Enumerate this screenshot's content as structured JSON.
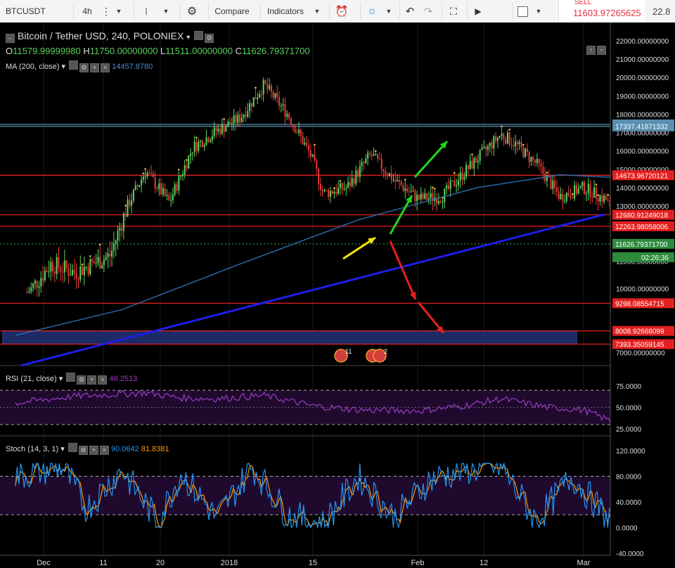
{
  "toolbar": {
    "symbol": "BTCUSDT",
    "interval": "4h",
    "compare_label": "Compare",
    "indicators_label": "Indicators",
    "sell_label": "SELL",
    "sell_price": "11603.97265625",
    "partial_value": "22.8"
  },
  "legend": {
    "title": "Bitcoin / Tether USD, 240, POLONIEX",
    "o_label": "O",
    "o_value": "11579.99999980",
    "h_label": "H",
    "h_value": "11750.00000000",
    "l_label": "L",
    "l_value": "11511.00000000",
    "c_label": "C",
    "c_value": "11626.79371700",
    "ma_label": "MA (200, close)",
    "ma_value": "14457.8780",
    "rsi_label": "RSI (21, close)",
    "rsi_value": "46.2513",
    "stoch_label": "Stoch (14, 3, 1)",
    "stoch_k": "90.0642",
    "stoch_d": "81.8381"
  },
  "colors": {
    "up": "#5fd65f",
    "down": "#e53b3b",
    "ma": "#2d6fb3",
    "trendline": "#1e1ee6",
    "level_line": "#e41f1f",
    "rsi": "#9c3bc2",
    "stoch_k": "#2196f3",
    "stoch_d": "#ff9800",
    "panel_bg": "#1f0a2e",
    "zone": "#1c2a66"
  },
  "chart_data": {
    "type": "candlestick",
    "symbol": "Bitcoin / Tether USD",
    "timeframe": "240",
    "exchange": "POLONIEX",
    "price_axis": [
      "22000.00000000",
      "21000.00000000",
      "20000.00000000",
      "19000.00000000",
      "18000.00000000",
      "17000.00000000",
      "16000.00000000",
      "15000.00000000",
      "14000.00000000",
      "13000.00000000",
      "11000.00000000",
      "10000.00000000",
      "7000.00000000"
    ],
    "price_levels": [
      {
        "price": 17443.41629621,
        "label": "17443.41629621",
        "color": "#5a8fb0"
      },
      {
        "price": 17337.41871332,
        "label": "17337.41871332",
        "color": "#5a8fb0"
      },
      {
        "price": 14673.96720121,
        "label": "14673.96720121",
        "color": "#e41f1f"
      },
      {
        "price": 12680.91249018,
        "label": "12680.91249018",
        "color": "#e41f1f"
      },
      {
        "price": 12263.98058006,
        "label": "12263.98058006",
        "color": "#e41f1f"
      },
      {
        "price": 11626.793717,
        "label": "11626.79371700",
        "color": "#2e8b3d"
      },
      {
        "price": 9298.08554715,
        "label": "9298.08554715",
        "color": "#e41f1f"
      },
      {
        "price": 8008.92668099,
        "label": "8008.92668099",
        "color": "#e41f1f"
      },
      {
        "price": 7393.35059145,
        "label": "7393.35059145",
        "color": "#e41f1f"
      }
    ],
    "countdown": "02:26:36",
    "time_axis": [
      "Dec",
      "11",
      "20",
      "2018",
      "15",
      "Feb",
      "12",
      "Mar"
    ],
    "price_path": [
      [
        "2017-11-27",
        9800
      ],
      [
        "2017-11-29",
        10900
      ],
      [
        "2017-12-01",
        10600
      ],
      [
        "2017-12-04",
        11200
      ],
      [
        "2017-12-07",
        14900
      ],
      [
        "2017-12-09",
        13200
      ],
      [
        "2017-12-11",
        16200
      ],
      [
        "2017-12-13",
        17100
      ],
      [
        "2017-12-15",
        17800
      ],
      [
        "2017-12-17",
        19600
      ],
      [
        "2017-12-19",
        18000
      ],
      [
        "2017-12-21",
        15700
      ],
      [
        "2017-12-22",
        13700
      ],
      [
        "2017-12-24",
        14000
      ],
      [
        "2017-12-26",
        15800
      ],
      [
        "2017-12-28",
        14400
      ],
      [
        "2017-12-30",
        13400
      ],
      [
        "2018-01-01",
        13500
      ],
      [
        "2018-01-03",
        14900
      ],
      [
        "2018-01-06",
        16900
      ],
      [
        "2018-01-07",
        16500
      ],
      [
        "2018-01-09",
        15300
      ],
      [
        "2018-01-11",
        13500
      ],
      [
        "2018-01-13",
        14000
      ],
      [
        "2018-01-15",
        13300
      ],
      [
        "2018-01-16",
        10700
      ],
      [
        "2018-01-17",
        10200
      ],
      [
        "2018-01-18",
        11300
      ],
      [
        "2018-01-19",
        11627
      ]
    ],
    "ma_path": [
      [
        "2017-11-26",
        7800
      ],
      [
        "2017-12-05",
        9000
      ],
      [
        "2017-12-15",
        10900
      ],
      [
        "2017-12-25",
        12500
      ],
      [
        "2018-01-04",
        14000
      ],
      [
        "2018-01-11",
        14700
      ],
      [
        "2018-01-14",
        14600
      ],
      [
        "2018-01-19",
        14457.878
      ]
    ],
    "rsi_axis": [
      "75.0000",
      "50.0000",
      "25.0000"
    ],
    "rsi_levels": [
      70,
      30
    ],
    "rsi_path": [
      [
        "2017-11-26",
        55
      ],
      [
        "2017-12-01",
        63
      ],
      [
        "2017-12-07",
        67
      ],
      [
        "2017-12-10",
        61
      ],
      [
        "2017-12-13",
        60
      ],
      [
        "2017-12-17",
        64
      ],
      [
        "2017-12-21",
        52
      ],
      [
        "2017-12-25",
        47
      ],
      [
        "2017-12-30",
        46
      ],
      [
        "2018-01-03",
        52
      ],
      [
        "2018-01-06",
        60
      ],
      [
        "2018-01-10",
        50
      ],
      [
        "2018-01-13",
        47
      ],
      [
        "2018-01-16",
        30
      ],
      [
        "2018-01-19",
        46.2513
      ]
    ],
    "stoch_axis": [
      "120.0000",
      "80.0000",
      "40.0000",
      "0.0000",
      "-40.0000"
    ],
    "stoch_levels": [
      80,
      20
    ],
    "stoch_k_path": [
      [
        "2017-11-26",
        80
      ],
      [
        "2017-11-30",
        95
      ],
      [
        "2017-12-02",
        30
      ],
      [
        "2017-12-05",
        90
      ],
      [
        "2017-12-08",
        10
      ],
      [
        "2017-12-10",
        85
      ],
      [
        "2017-12-13",
        15
      ],
      [
        "2017-12-16",
        95
      ],
      [
        "2017-12-19",
        20
      ],
      [
        "2017-12-22",
        5
      ],
      [
        "2017-12-25",
        80
      ],
      [
        "2017-12-28",
        15
      ],
      [
        "2017-12-31",
        75
      ],
      [
        "2018-01-03",
        90
      ],
      [
        "2018-01-06",
        95
      ],
      [
        "2018-01-09",
        10
      ],
      [
        "2018-01-12",
        80
      ],
      [
        "2018-01-15",
        15
      ],
      [
        "2018-01-17",
        5
      ],
      [
        "2018-01-19",
        90.0642
      ]
    ],
    "annotations": [
      {
        "label": "11",
        "date": "2018-01-16"
      },
      {
        "label": "7",
        "date": "2018-01-19"
      },
      {
        "label": "2",
        "date": "2018-01-20"
      }
    ]
  }
}
